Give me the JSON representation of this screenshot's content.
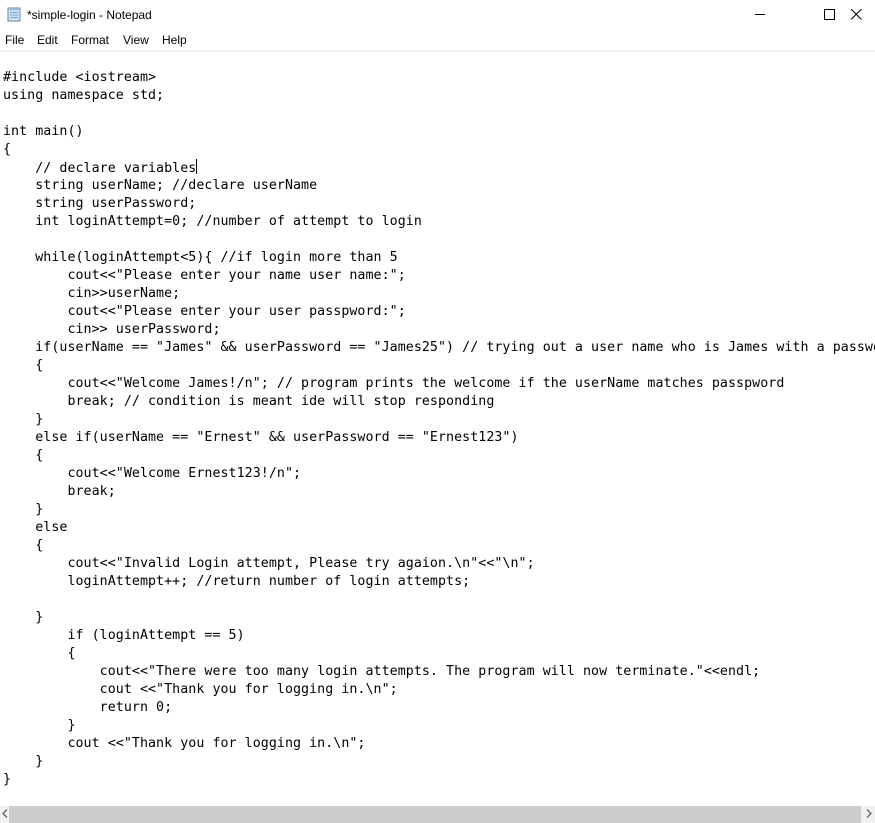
{
  "window": {
    "title": "*simple-login - Notepad",
    "icon": "notepad-icon",
    "controls": {
      "minimize": "minimize-icon",
      "maximize": "maximize-icon",
      "close": "close-icon"
    }
  },
  "menu": {
    "items": [
      {
        "label": "File"
      },
      {
        "label": "Edit"
      },
      {
        "label": "Format"
      },
      {
        "label": "View"
      },
      {
        "label": "Help"
      }
    ]
  },
  "editor": {
    "caret_line": 6,
    "lines": [
      "",
      "#include <iostream>",
      "using namespace std;",
      "",
      "int main()",
      "{",
      "    // declare variables",
      "    string userName; //declare userName",
      "    string userPassword;",
      "    int loginAttempt=0; //number of attempt to login",
      "",
      "    while(loginAttempt<5){ //if login more than 5",
      "        cout<<\"Please enter your name user name:\";",
      "        cin>>userName;",
      "        cout<<\"Please enter your user passpword:\";",
      "        cin>> userPassword;",
      "    if(userName == \"James\" && userPassword == \"James25\") // trying out a user name who is James with a passwo",
      "    {",
      "        cout<<\"Welcome James!/n\"; // program prints the welcome if the userName matches passpword",
      "        break; // condition is meant ide will stop responding",
      "    }",
      "    else if(userName == \"Ernest\" && userPassword == \"Ernest123\")",
      "    {",
      "        cout<<\"Welcome Ernest123!/n\";",
      "        break;",
      "    }",
      "    else",
      "    {",
      "        cout<<\"Invalid Login attempt, Please try agaion.\\n\"<<\"\\n\";",
      "        loginAttempt++; //return number of login attempts;",
      "",
      "    }",
      "        if (loginAttempt == 5)",
      "        {",
      "            cout<<\"There were too many login attempts. The program will now terminate.\"<<endl;",
      "            cout <<\"Thank you for logging in.\\n\";",
      "            return 0;",
      "        }",
      "        cout <<\"Thank you for logging in.\\n\";",
      "    }",
      "}"
    ]
  },
  "scrollbar": {
    "horizontal": {
      "left_arrow": "chevron-left-icon",
      "right_arrow": "chevron-right-icon",
      "thumb_fraction": 0.58
    }
  }
}
